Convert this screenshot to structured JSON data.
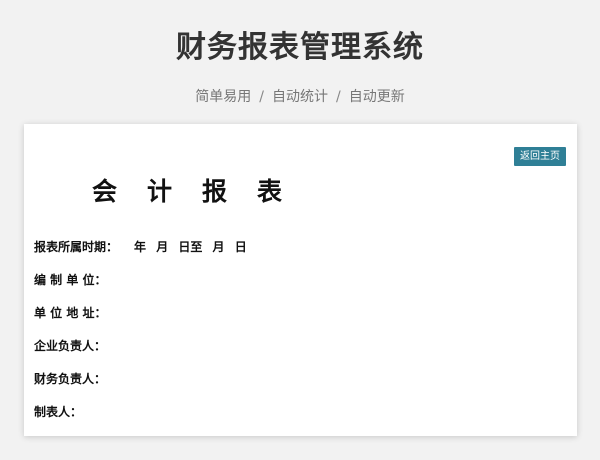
{
  "header": {
    "title": "财务报表管理系统",
    "features": [
      "简单易用",
      "自动统计",
      "自动更新"
    ],
    "separator": "/"
  },
  "card": {
    "back_button_label": "返回主页",
    "report_title_chars": [
      "会",
      "计",
      "报",
      "表"
    ],
    "fields": [
      {
        "label": "报表所属时期：",
        "value": "年  月  日至  月  日"
      },
      {
        "label": "编 制 单 位：",
        "value": ""
      },
      {
        "label": "单 位 地 址：",
        "value": ""
      },
      {
        "label": "企业负责人：",
        "value": ""
      },
      {
        "label": "财务负责人：",
        "value": ""
      },
      {
        "label": "制表人：",
        "value": ""
      }
    ]
  },
  "colors": {
    "accent": "#2f7f96",
    "background": "#f2f2f2"
  }
}
